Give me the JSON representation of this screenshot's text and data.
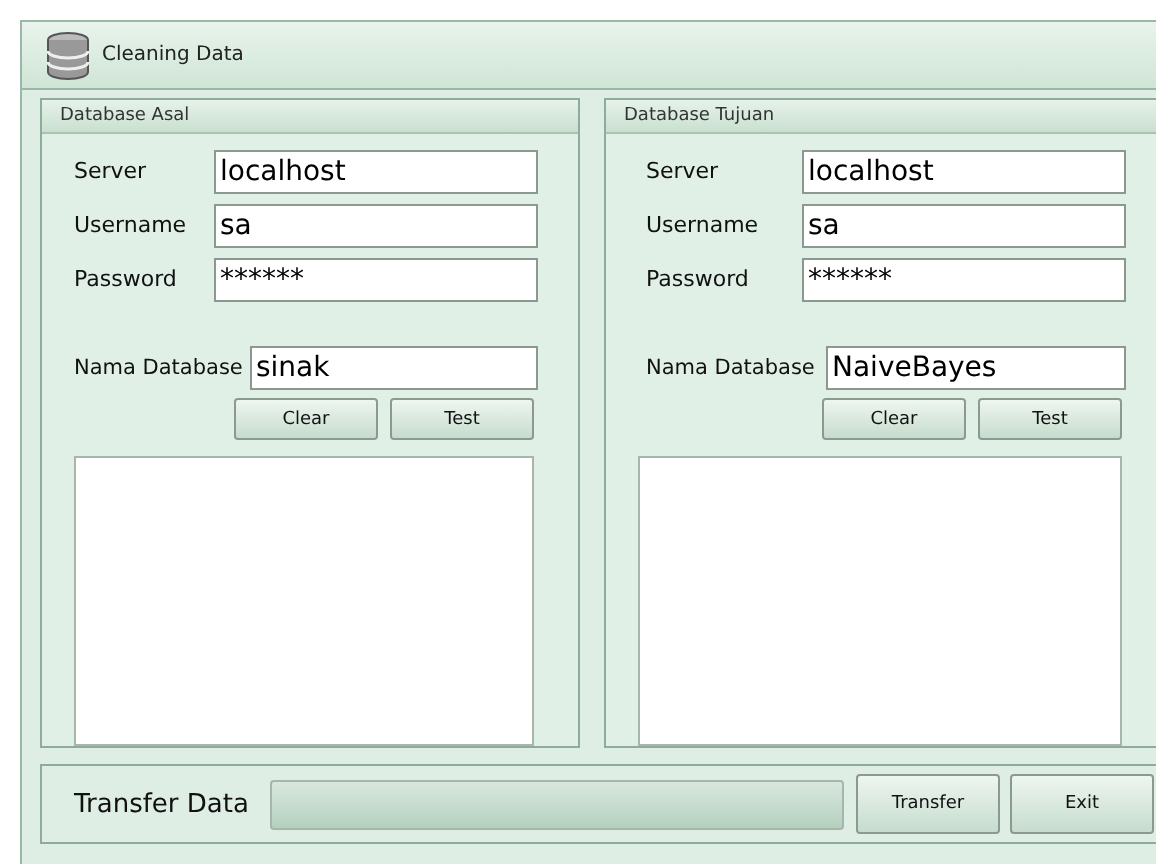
{
  "window": {
    "title": "Cleaning Data"
  },
  "panels": [
    {
      "title": "Database Asal",
      "fields": [
        {
          "label": "Server",
          "value": "localhost"
        },
        {
          "label": "Username",
          "value": "sa"
        },
        {
          "label": "Password",
          "value": "******"
        }
      ],
      "database": {
        "label": "Nama Database",
        "value": "sinak"
      },
      "buttons": [
        "Clear",
        "Test"
      ]
    },
    {
      "title": "Database Tujuan",
      "fields": [
        {
          "label": "Server",
          "value": "localhost"
        },
        {
          "label": "Username",
          "value": "sa"
        },
        {
          "label": "Password",
          "value": "******"
        }
      ],
      "database": {
        "label": "Nama Database",
        "value": "NaiveBayes"
      },
      "buttons": [
        "Clear",
        "Test"
      ]
    }
  ],
  "transfer": {
    "label": "Transfer Data",
    "progress": {
      "level": 0
    },
    "buttons": [
      "Transfer",
      "Exit"
    ]
  }
}
